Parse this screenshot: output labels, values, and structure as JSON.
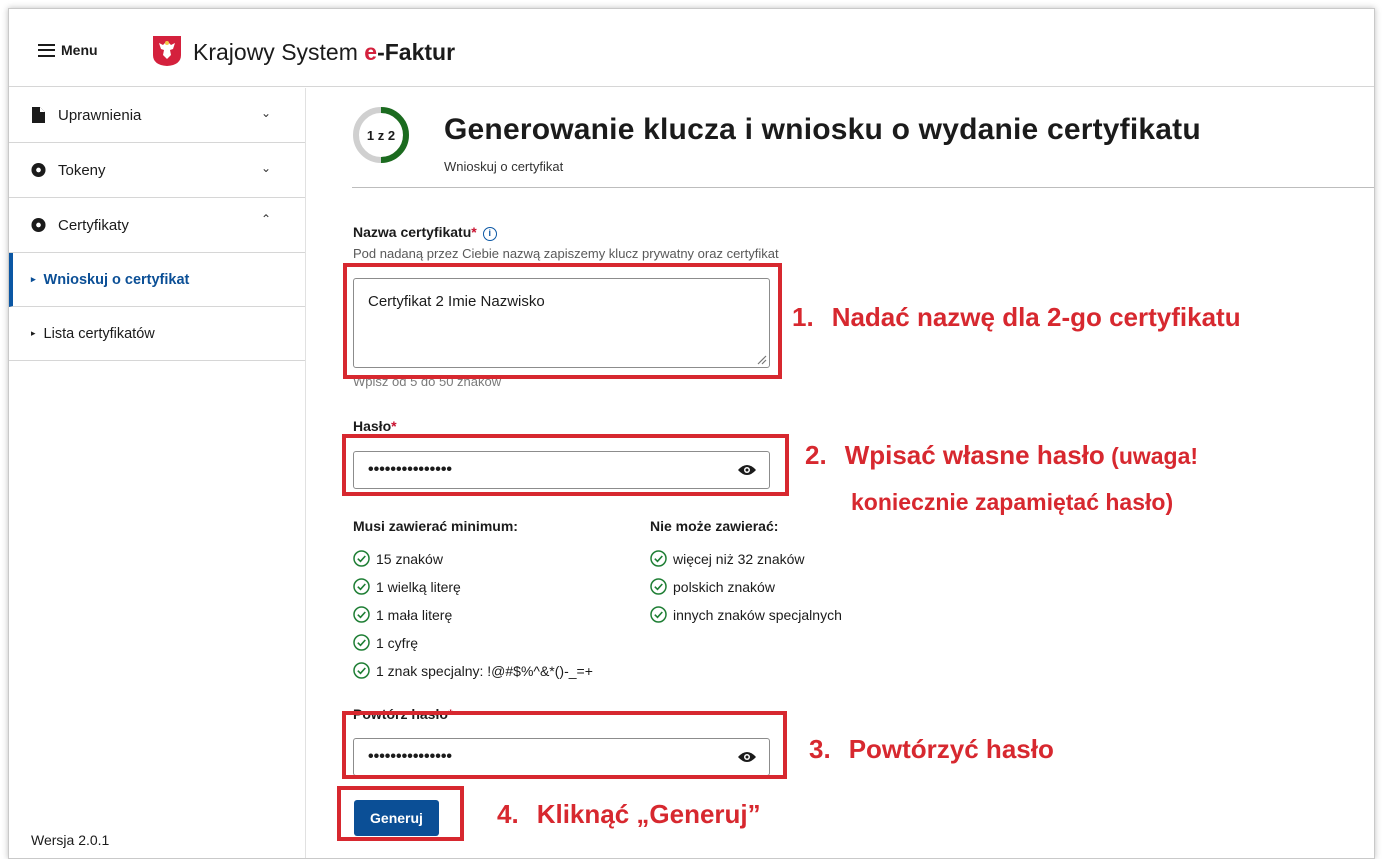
{
  "header": {
    "menu_label": "Menu",
    "app_title_prefix": "Krajowy System ",
    "app_title_e": "e",
    "app_title_suffix": "-Faktur"
  },
  "sidebar": {
    "items": [
      {
        "label": "Uprawnienia",
        "icon": "document-icon",
        "state": "collapsed"
      },
      {
        "label": "Tokeny",
        "icon": "token-icon",
        "state": "collapsed"
      },
      {
        "label": "Certyfikaty",
        "icon": "certificate-icon",
        "state": "expanded"
      }
    ],
    "sub_items": [
      {
        "label": "Wnioskuj o certyfikat",
        "active": true
      },
      {
        "label": "Lista certyfikatów",
        "active": false
      }
    ],
    "version": "Wersja 2.0.1"
  },
  "main": {
    "step": "1 z 2",
    "step_progress": 0.5,
    "title": "Generowanie klucza i wniosku o wydanie certyfikatu",
    "subtitle": "Wnioskuj o certyfikat",
    "cert_name": {
      "label": "Nazwa certyfikatu",
      "required_mark": "*",
      "info_icon": "i",
      "hint": "Pod nadaną przez Ciebie nazwą zapiszemy klucz prywatny oraz certyfikat",
      "value": "Certyfikat 2 Imie Nazwisko",
      "helper": "Wpisz od 5 do 50 znaków"
    },
    "password": {
      "label": "Hasło",
      "required_mark": "*",
      "value_masked": "•••••••••••••••"
    },
    "requirements": {
      "must_title": "Musi zawierać minimum:",
      "must": [
        "15 znaków",
        "1 wielką literę",
        "1 mała literę",
        "1 cyfrę",
        "1 znak specjalny: !@#$%^&*()-_=+"
      ],
      "cannot_title": "Nie może zawierać:",
      "cannot": [
        "więcej niż 32 znaków",
        "polskich znaków",
        "innych znaków specjalnych"
      ]
    },
    "repeat_password": {
      "label": "Powtórz hasło",
      "required_mark": "*",
      "value_masked": "•••••••••••••••"
    },
    "generate_button": "Generuj"
  },
  "annotations": {
    "note1_num": "1.",
    "note1": "Nadać nazwę dla 2-go certyfikatu",
    "note2_num": "2.",
    "note2_line1": "Wpisać własne hasło",
    "note2_line1b": " (uwaga!",
    "note2_line2": "koniecznie zapamiętać hasło)",
    "note3_num": "3.",
    "note3": "Powtórzyć hasło",
    "note4_num": "4.",
    "note4": "Kliknąć „Generuj”"
  },
  "colors": {
    "primary": "#0b4f96",
    "annotation_red": "#d7282f",
    "success_green": "#1e7e34",
    "required_red": "#c8102e",
    "progress_green": "#1b6b1f"
  }
}
